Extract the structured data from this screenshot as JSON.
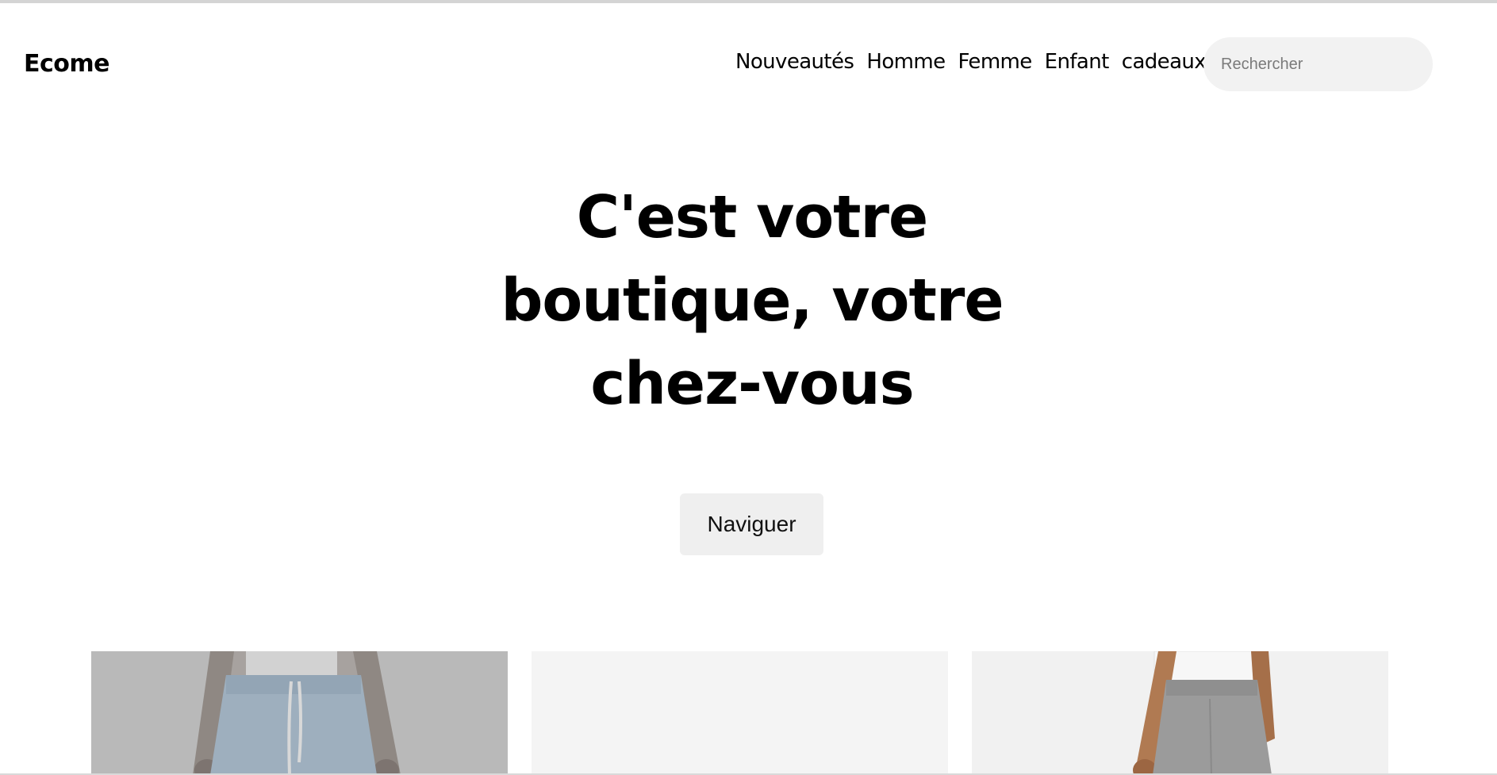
{
  "header": {
    "logo": "Ecome",
    "nav": [
      "Nouveautés",
      "Homme",
      "Femme",
      "Enfant",
      "cadeaux"
    ],
    "search_placeholder": "Rechercher"
  },
  "hero": {
    "title_lines": [
      "C'est votre",
      "boutique, votre",
      "chez-vous"
    ],
    "cta_label": "Naviguer"
  },
  "products": [
    {
      "image": "light-blue-shorts-photo"
    },
    {
      "image": "blank-product-photo"
    },
    {
      "image": "grey-sweat-shorts-photo"
    }
  ]
}
